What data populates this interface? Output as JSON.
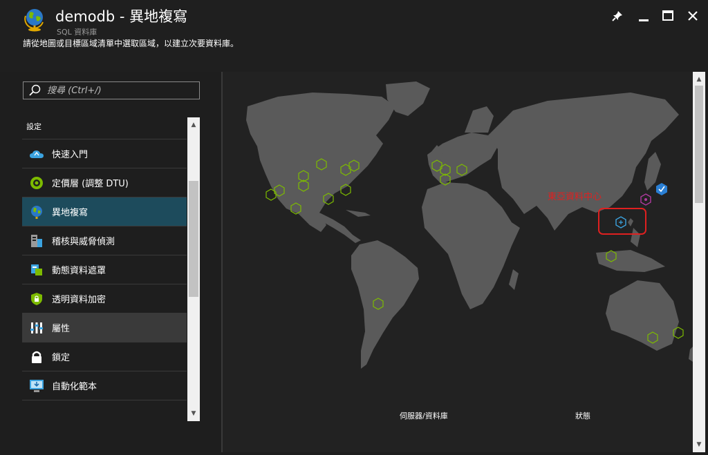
{
  "header": {
    "title": "demodb - 異地複寫",
    "subtitle": "SQL 資料庫",
    "instruction": "請從地圖或目標區域清單中選取區域，以建立次要資料庫。"
  },
  "search": {
    "placeholder": "搜尋 (Ctrl+/)"
  },
  "menu": {
    "section": "設定",
    "items": [
      {
        "label": "快速入門",
        "icon": "cloud-icon"
      },
      {
        "label": "定價層 (調整 DTU)",
        "icon": "pricing-icon"
      },
      {
        "label": "異地複寫",
        "icon": "globe-icon"
      },
      {
        "label": "稽核與威脅偵測",
        "icon": "audit-icon"
      },
      {
        "label": "動態資料遮罩",
        "icon": "masking-icon"
      },
      {
        "label": "透明資料加密",
        "icon": "shield-icon"
      },
      {
        "label": "屬性",
        "icon": "properties-icon"
      },
      {
        "label": "鎖定",
        "icon": "lock-icon"
      },
      {
        "label": "自動化範本",
        "icon": "automation-icon"
      }
    ]
  },
  "map": {
    "annotation": "東亞資料中心",
    "columns": {
      "server_db": "伺服器/資料庫",
      "status": "狀態"
    }
  },
  "colors": {
    "land": "#5a5a5a",
    "ocean": "#222222",
    "region_hex": "#7dbb00",
    "primary": "#3ba3e0",
    "annotation": "#e02020",
    "active_menu": "#1d4b5c"
  }
}
